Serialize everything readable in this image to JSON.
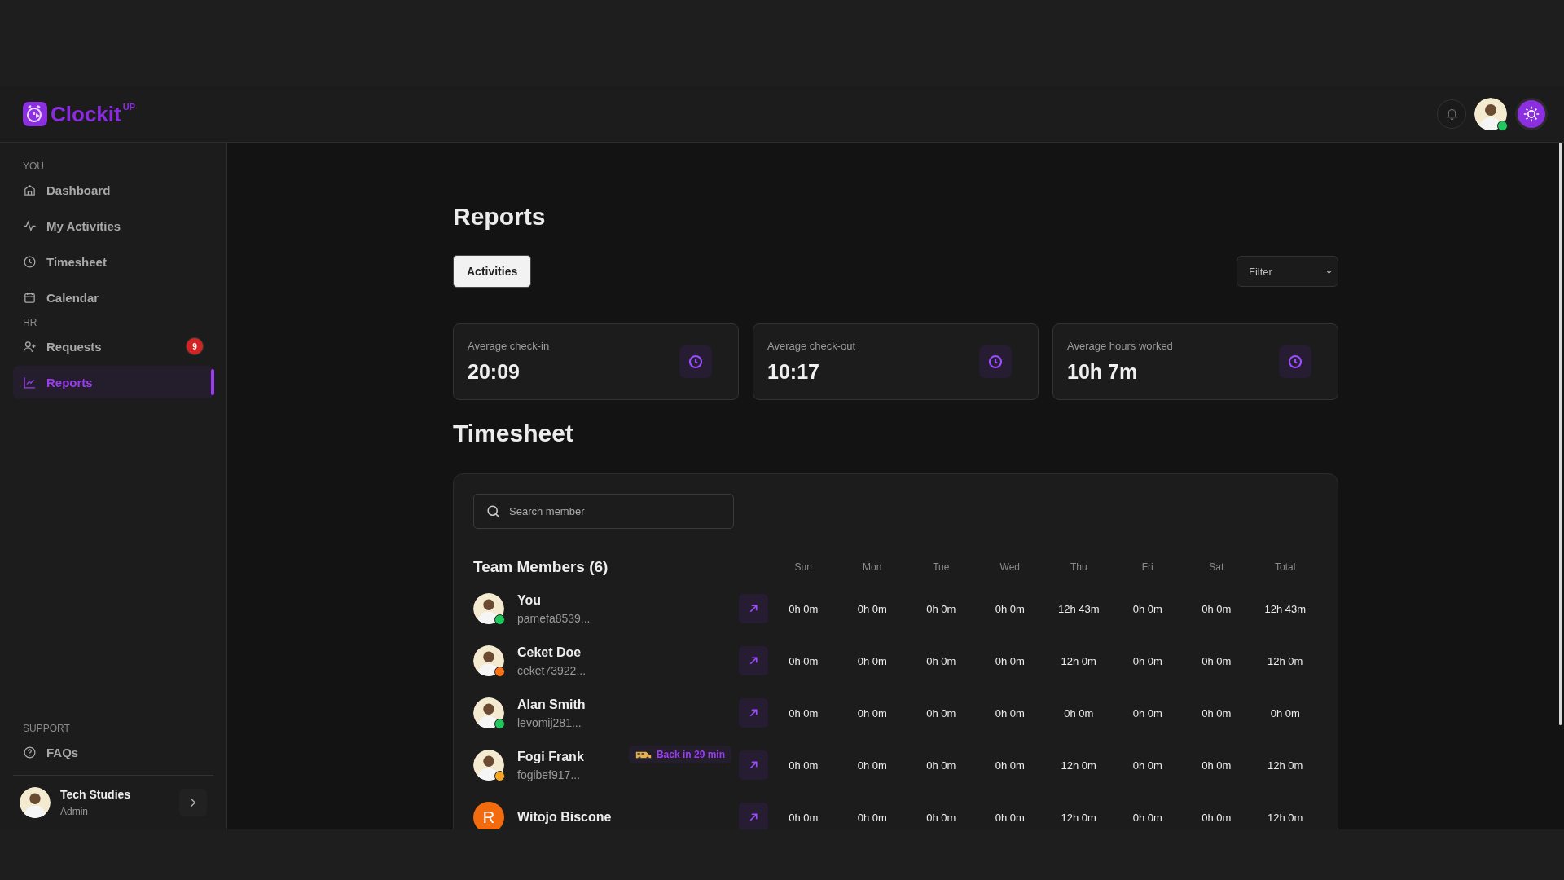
{
  "header": {
    "logo": {
      "name": "Clockit",
      "superscript": "UP"
    },
    "user": {
      "color": "#22c55e"
    }
  },
  "sidebar": {
    "sections": [
      {
        "heading": "YOU",
        "items": [
          {
            "label": "Dashboard",
            "selected": false
          },
          {
            "label": "My Activities",
            "selected": false
          },
          {
            "label": "Timesheet",
            "selected": false
          },
          {
            "label": "Calendar",
            "selected": false
          }
        ]
      },
      {
        "heading": "HR",
        "items": [
          {
            "label": "Requests",
            "selected": false,
            "badge": "9"
          },
          {
            "label": "Reports",
            "selected": true
          }
        ]
      }
    ],
    "support": {
      "heading": "SUPPORT",
      "items": [
        {
          "label": "FAQs",
          "selected": false
        }
      ]
    },
    "user": {
      "name": "Tech Studies",
      "role": "Admin"
    }
  },
  "page": {
    "title": "Reports",
    "tabs": [
      {
        "label": "Activities",
        "selected": true
      }
    ],
    "filter": {
      "placeholder": "Filter"
    },
    "stats": [
      {
        "label": "Average check-in",
        "value": "20:09"
      },
      {
        "label": "Average check-out",
        "value": "10:17"
      },
      {
        "label": "Average hours worked",
        "value": "10h 7m"
      }
    ]
  },
  "timesheet": {
    "title": "Timesheet",
    "search": {
      "placeholder": "Search member"
    },
    "members_title": "Team Members (6)",
    "columns": [
      "Sun",
      "Mon",
      "Tue",
      "Wed",
      "Thu",
      "Fri",
      "Sat",
      "Total"
    ],
    "rows": [
      {
        "name": "You",
        "email": "pamefa8539...",
        "avatar": {
          "kind": "photo"
        },
        "color": "#22c55e",
        "hours": [
          "0h 0m",
          "0h 0m",
          "0h 0m",
          "0h 0m",
          "12h 43m",
          "0h 0m",
          "0h 0m",
          "12h 43m"
        ]
      },
      {
        "name": "Ceket Doe",
        "email": "ceket73922...",
        "avatar": {
          "kind": "photo"
        },
        "color": "#f97316",
        "hours": [
          "0h 0m",
          "0h 0m",
          "0h 0m",
          "0h 0m",
          "12h 0m",
          "0h 0m",
          "0h 0m",
          "12h 0m"
        ]
      },
      {
        "name": "Alan Smith",
        "email": "levomij281...",
        "avatar": {
          "kind": "photo"
        },
        "color": "#22c55e",
        "hours": [
          "0h 0m",
          "0h 0m",
          "0h 0m",
          "0h 0m",
          "0h 0m",
          "0h 0m",
          "0h 0m",
          "0h 0m"
        ]
      },
      {
        "name": "Fogi Frank",
        "email": "fogibef917...",
        "avatar": {
          "kind": "photo"
        },
        "color": "#f5a524",
        "status": "Back in 29 min",
        "hours": [
          "0h 0m",
          "0h 0m",
          "0h 0m",
          "0h 0m",
          "12h 0m",
          "0h 0m",
          "0h 0m",
          "12h 0m"
        ]
      },
      {
        "name": "Witojo Biscone",
        "avatar": {
          "kind": "letter",
          "letter": "R"
        },
        "hours": [
          "0h 0m",
          "0h 0m",
          "0h 0m",
          "0h 0m",
          "12h 0m",
          "0h 0m",
          "0h 0m",
          "12h 0m"
        ]
      }
    ]
  }
}
